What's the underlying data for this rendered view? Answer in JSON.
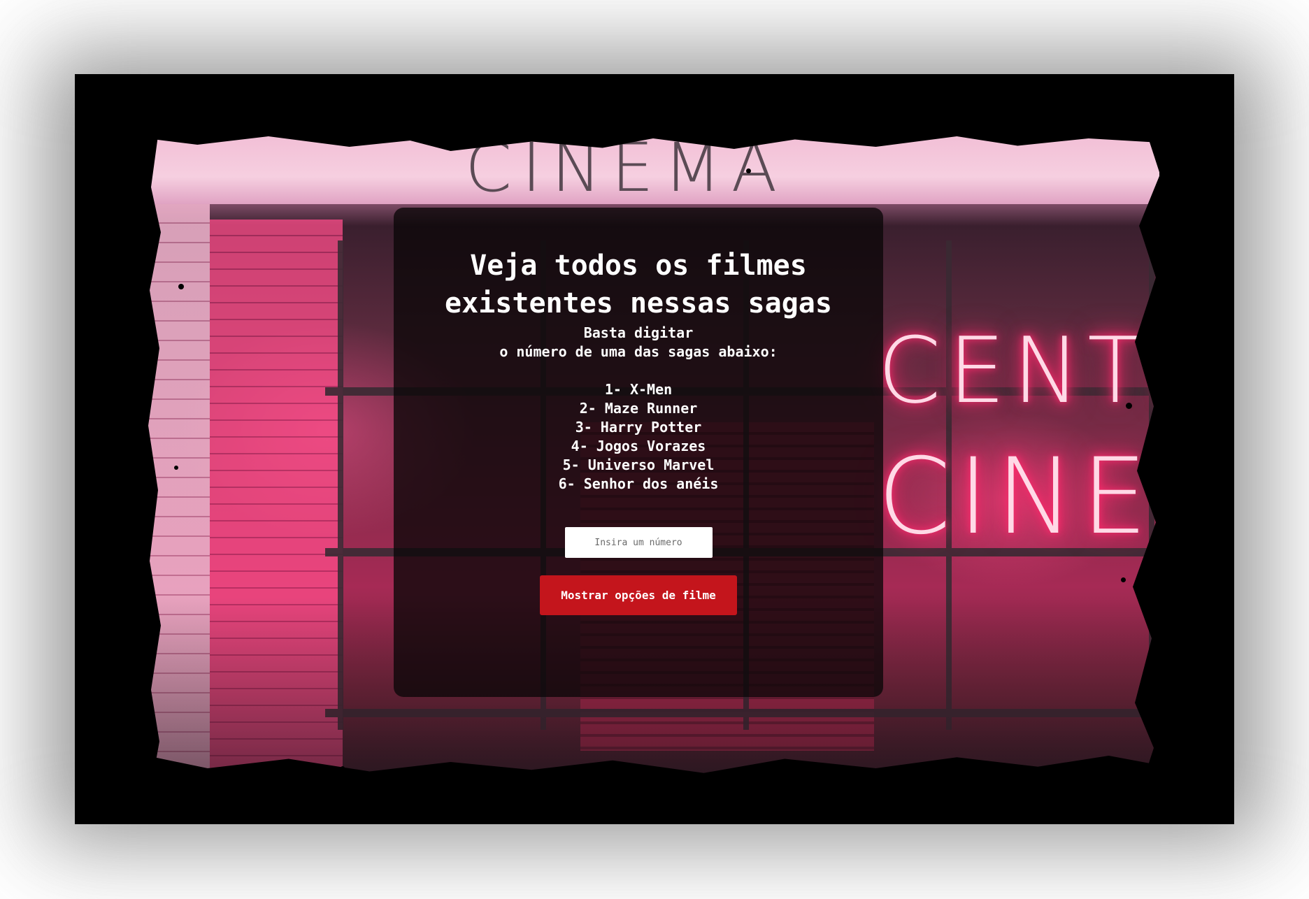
{
  "background": {
    "sign_text": "CINEMA",
    "neon_line_1": "CENTR",
    "neon_line_2": "CINE"
  },
  "panel": {
    "title_line_1": "Veja todos os filmes",
    "title_line_2": "existentes nessas sagas",
    "subtitle_line_1": "Basta digitar",
    "subtitle_line_2": "o número de uma das sagas abaixo:",
    "sagas": [
      "1- X-Men",
      "2- Maze Runner",
      "3- Harry Potter",
      "4- Jogos Vorazes",
      "5- Universo Marvel",
      "6- Senhor dos anéis"
    ],
    "input_placeholder": "Insira um número",
    "input_value": "",
    "button_label": "Mostrar opções de filme"
  },
  "colors": {
    "panel_background": "#0a0608",
    "button": "#c4151c",
    "neon_glow": "#ff2a6d",
    "frame": "#000000"
  }
}
